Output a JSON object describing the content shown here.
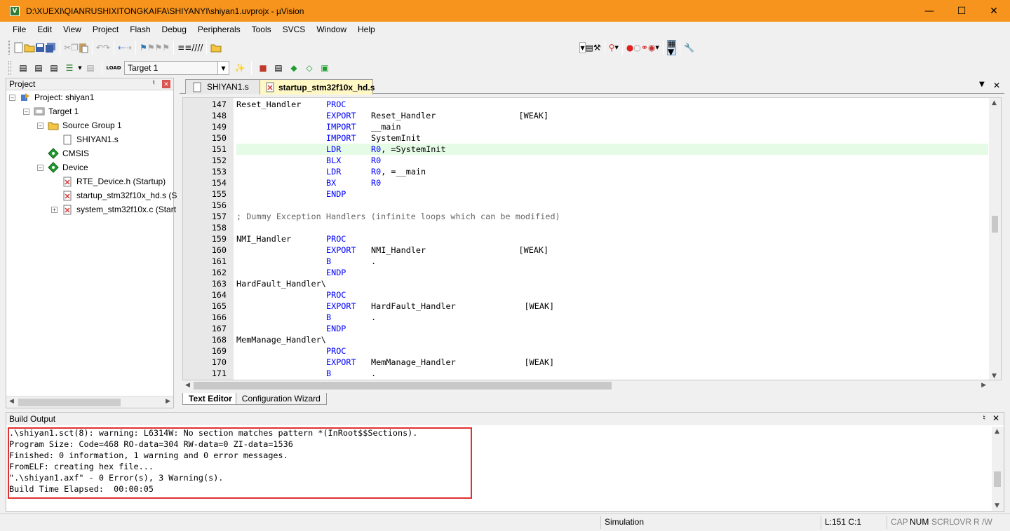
{
  "window": {
    "title": "D:\\XUEXI\\QIANRUSHIXITONGKAIFA\\SHIYANYI\\shiyan1.uvprojx - µVision",
    "app_icon_letter": "V"
  },
  "menu": [
    "File",
    "Edit",
    "View",
    "Project",
    "Flash",
    "Debug",
    "Peripherals",
    "Tools",
    "SVCS",
    "Window",
    "Help"
  ],
  "toolbar2": {
    "target_select": "Target 1"
  },
  "project_panel": {
    "title": "Project",
    "tree": [
      {
        "label": "Project: shiyan1",
        "icon": "project-icon"
      },
      {
        "label": "Target 1",
        "icon": "target-icon"
      },
      {
        "label": "Source Group 1",
        "icon": "folder-icon"
      },
      {
        "label": "SHIYAN1.s",
        "icon": "file-icon"
      },
      {
        "label": "CMSIS",
        "icon": "component-icon"
      },
      {
        "label": "Device",
        "icon": "component-icon"
      },
      {
        "label": "RTE_Device.h (Startup)",
        "icon": "rte-file-icon"
      },
      {
        "label": "startup_stm32f10x_hd.s (S",
        "icon": "rte-file-icon"
      },
      {
        "label": "system_stm32f10x.c (Start",
        "icon": "rte-file-icon"
      }
    ]
  },
  "editor": {
    "tabs": [
      {
        "label": "SHIYAN1.s",
        "active": false
      },
      {
        "label": "startup_stm32f10x_hd.s",
        "active": true
      }
    ],
    "bottom_tabs": [
      "Text Editor",
      "Configuration Wizard"
    ],
    "lines": [
      {
        "n": "147",
        "label": "Reset_Handler",
        "kw": "PROC",
        "op": "",
        "attr": ""
      },
      {
        "n": "148",
        "label": "",
        "kw": "EXPORT",
        "op": "Reset_Handler",
        "attr": "[WEAK]"
      },
      {
        "n": "149",
        "label": "",
        "kw": "IMPORT",
        "op": "__main",
        "attr": ""
      },
      {
        "n": "150",
        "label": "",
        "kw": "IMPORT",
        "op": "SystemInit",
        "attr": ""
      },
      {
        "n": "151",
        "label": "",
        "kw": "LDR",
        "op": "R0, =SystemInit",
        "attr": ""
      },
      {
        "n": "152",
        "label": "",
        "kw": "BLX",
        "op": "R0",
        "attr": ""
      },
      {
        "n": "153",
        "label": "",
        "kw": "LDR",
        "op": "R0, =__main",
        "attr": ""
      },
      {
        "n": "154",
        "label": "",
        "kw": "BX",
        "op": "R0",
        "attr": ""
      },
      {
        "n": "155",
        "label": "",
        "kw": "ENDP",
        "op": "",
        "attr": ""
      },
      {
        "n": "156",
        "label": "",
        "kw": "",
        "op": "",
        "attr": ""
      },
      {
        "n": "157",
        "comment": "; Dummy Exception Handlers (infinite loops which can be modified)"
      },
      {
        "n": "158",
        "label": "",
        "kw": "",
        "op": "",
        "attr": ""
      },
      {
        "n": "159",
        "label": "NMI_Handler",
        "kw": "PROC",
        "op": "",
        "attr": ""
      },
      {
        "n": "160",
        "label": "",
        "kw": "EXPORT",
        "op": "NMI_Handler",
        "attr": "[WEAK]"
      },
      {
        "n": "161",
        "label": "",
        "kw": "B",
        "op": ".",
        "attr": ""
      },
      {
        "n": "162",
        "label": "",
        "kw": "ENDP",
        "op": "",
        "attr": ""
      },
      {
        "n": "163",
        "label": "HardFault_Handler\\",
        "kw": "",
        "op": "",
        "attr": ""
      },
      {
        "n": "164",
        "label": "",
        "kw": "PROC",
        "op": "",
        "attr": ""
      },
      {
        "n": "165",
        "label": "",
        "kw": "EXPORT",
        "op": "HardFault_Handler",
        "attr": "[WEAK]"
      },
      {
        "n": "166",
        "label": "",
        "kw": "B",
        "op": ".",
        "attr": ""
      },
      {
        "n": "167",
        "label": "",
        "kw": "ENDP",
        "op": "",
        "attr": ""
      },
      {
        "n": "168",
        "label": "MemManage_Handler\\",
        "kw": "",
        "op": "",
        "attr": ""
      },
      {
        "n": "169",
        "label": "",
        "kw": "PROC",
        "op": "",
        "attr": ""
      },
      {
        "n": "170",
        "label": "",
        "kw": "EXPORT",
        "op": "MemManage_Handler",
        "attr": "[WEAK]"
      },
      {
        "n": "171",
        "label": "",
        "kw": "B",
        "op": ".",
        "attr": ""
      }
    ]
  },
  "build_output": {
    "title": "Build Output",
    "lines": [
      ".\\shiyan1.sct(8): warning: L6314W: No section matches pattern *(InRoot$$Sections).",
      "Program Size: Code=468 RO-data=304 RW-data=0 ZI-data=1536",
      "Finished: 0 information, 1 warning and 0 error messages.",
      "FromELF: creating hex file...",
      "\".\\shiyan1.axf\" - 0 Error(s), 3 Warning(s).",
      "Build Time Elapsed:  00:00:05"
    ]
  },
  "status": {
    "mode": "Simulation",
    "cursor": "L:151 C:1",
    "cap": "CAP",
    "num": "NUM",
    "scrl": "SCRL",
    "ovr": "OVR",
    "rw": "R /W"
  },
  "colors": {
    "titlebar": "#f7941d",
    "keyword": "#0000ff",
    "current_line": "#e5fbe6",
    "active_tab": "#fff8c4",
    "error_box": "#e03030"
  }
}
